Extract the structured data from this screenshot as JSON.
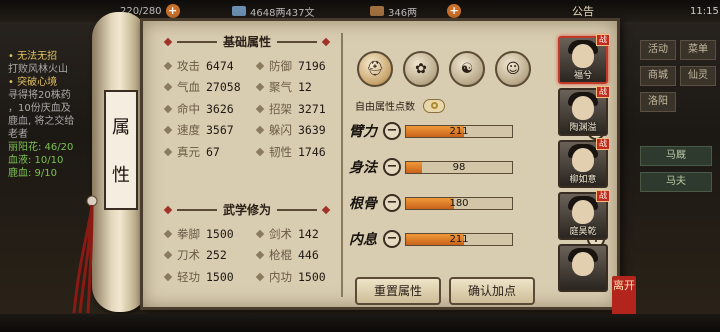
{
  "topbar": {
    "stamina": "220/280",
    "coins": "4648两437文",
    "reputation": "346两",
    "announce": "公告",
    "time": "11:15"
  },
  "left_log": [
    {
      "text": "• 无法无招",
      "style": "quest"
    },
    {
      "text": "打败风林火山",
      "style": ""
    },
    {
      "text": "• 突破心境",
      "style": "quest"
    },
    {
      "text": "寻得将20株药",
      "style": ""
    },
    {
      "text": "，10份庆血及",
      "style": ""
    },
    {
      "text": "鹿血, 将之交给",
      "style": ""
    },
    {
      "text": "老者",
      "style": ""
    },
    {
      "text": "丽阳花: 46/20",
      "style": "green"
    },
    {
      "text": "血液: 10/10",
      "style": "green"
    },
    {
      "text": "鹿血: 9/10",
      "style": "green"
    }
  ],
  "right_menu": {
    "row1": [
      "活动",
      "菜单"
    ],
    "row2": [
      "商城",
      "仙灵"
    ],
    "row3": [
      "洛阳"
    ],
    "wide": [
      "马厩",
      "马夫"
    ]
  },
  "scroll_title": [
    "属",
    "性"
  ],
  "basic_section": {
    "title": "基础属性",
    "rows": [
      [
        {
          "label": "攻击",
          "value": "6474"
        },
        {
          "label": "防御",
          "value": "7196"
        }
      ],
      [
        {
          "label": "气血",
          "value": "27058"
        },
        {
          "label": "聚气",
          "value": "12"
        }
      ],
      [
        {
          "label": "命中",
          "value": "3626"
        },
        {
          "label": "招架",
          "value": "3271"
        }
      ],
      [
        {
          "label": "速度",
          "value": "3567"
        },
        {
          "label": "躲闪",
          "value": "3639"
        }
      ],
      [
        {
          "label": "真元",
          "value": "67"
        },
        {
          "label": "韧性",
          "value": "1746"
        }
      ]
    ]
  },
  "martial_section": {
    "title": "武学修为",
    "rows": [
      [
        {
          "label": "拳脚",
          "value": "1500"
        },
        {
          "label": "剑术",
          "value": "142"
        }
      ],
      [
        {
          "label": "刀术",
          "value": "252"
        },
        {
          "label": "枪棍",
          "value": "446"
        }
      ],
      [
        {
          "label": "轻功",
          "value": "1500"
        },
        {
          "label": "内功",
          "value": "1500"
        }
      ]
    ]
  },
  "tab_icons": [
    {
      "name": "hat-icon",
      "active": true
    },
    {
      "name": "bag-icon",
      "active": false
    },
    {
      "name": "taiji-icon",
      "active": false
    },
    {
      "name": "body-icon",
      "active": false
    }
  ],
  "free_points_label": "自由属性点数",
  "attributes": [
    {
      "label": "臂力",
      "value": "211",
      "fill": 0.55
    },
    {
      "label": "身法",
      "value": "98",
      "fill": 0.15
    },
    {
      "label": "根骨",
      "value": "180",
      "fill": 0.45
    },
    {
      "label": "内息",
      "value": "211",
      "fill": 0.55
    }
  ],
  "buttons": {
    "reset": "重置属性",
    "confirm": "确认加点"
  },
  "characters": [
    {
      "name": "福兮",
      "selected": true,
      "badge": "战"
    },
    {
      "name": "陶渊溢",
      "selected": false,
      "badge": "战"
    },
    {
      "name": "柳如意",
      "selected": false,
      "badge": "战"
    },
    {
      "name": "庭昊乾",
      "selected": false,
      "badge": "战"
    },
    {
      "name": "",
      "selected": false,
      "badge": ""
    }
  ],
  "seal_text": "离开"
}
